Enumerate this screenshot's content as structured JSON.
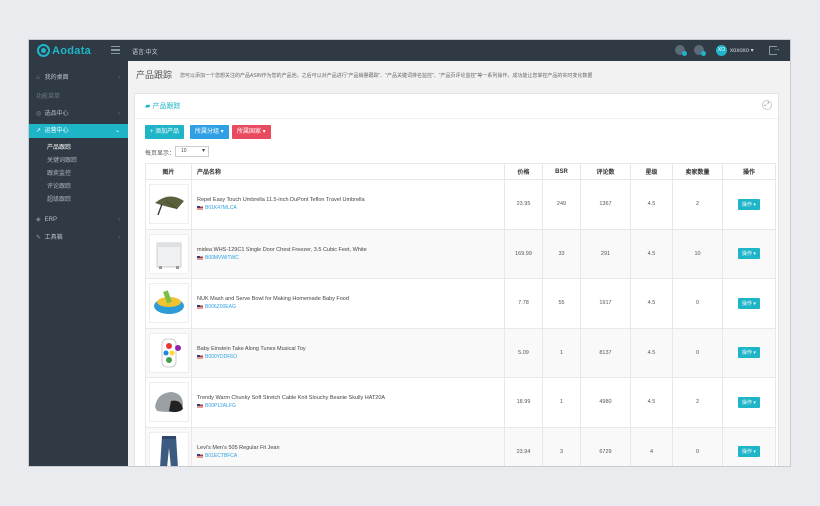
{
  "app": {
    "logo_text": "Aodata",
    "lang": "语言:中文",
    "user": "xoxoxo",
    "avatar": "XO"
  },
  "sidebar": {
    "items": [
      {
        "icon": "home-icon",
        "label": "我的桌面"
      },
      {
        "label": "功能菜单"
      },
      {
        "icon": "select-icon",
        "label": "选品中心"
      },
      {
        "icon": "chart-icon",
        "label": "运营中心"
      },
      {
        "icon": "erp-icon",
        "label": "ERP"
      },
      {
        "icon": "tools-icon",
        "label": "工具箱"
      }
    ],
    "sub_items": [
      "产品跟踪",
      "关键词跟踪",
      "跟卖监控",
      "评论跟踪",
      "超级跟踪"
    ]
  },
  "page": {
    "title": "产品跟踪",
    "desc": "您可以添加一个您想关注的产品ASIN作为您的产品池，之后可以对产品进行\"产品销量跟踪\"、\"产品关键词排名监控\"、\"产品页评论监控\"等一系列操作，成功能让您掌控产品的实时变化数据"
  },
  "panel": {
    "title": "产品跟踪",
    "btn_add": "+ 添加产品",
    "btn_group": "所属分组 ▾",
    "btn_country": "所属国家 ▾",
    "perpage_label": "每页显示：",
    "perpage_value": "10"
  },
  "table": {
    "headers": [
      "图片",
      "产品名称",
      "价格",
      "BSR",
      "评论数",
      "星级",
      "卖家数量",
      "操作"
    ],
    "rows": [
      {
        "img": "umbrella",
        "name": "Repel Easy Touch Umbrella 11.5-inch DuPont Teflon Travel Umbrella",
        "asin": "B01K47MLCA",
        "price": "23.95",
        "bsr": "249",
        "reviews": "1367",
        "stars": "4.5",
        "sellers": "2",
        "op": "操作 ▾"
      },
      {
        "img": "freezer",
        "name": "midea WHS-129C1 Single Door Chest Freezer, 3.5 Cubic Feet, White",
        "asin": "B00MVWITWC",
        "price": "169.99",
        "bsr": "33",
        "reviews": "291",
        "stars": "4.5",
        "sellers": "10",
        "op": "操作 ▾"
      },
      {
        "img": "bowl",
        "name": "NUK Mash and Serve Bowl for Making Homemade Baby Food",
        "asin": "B006Z00EAG",
        "price": "7.78",
        "bsr": "55",
        "reviews": "1917",
        "stars": "4.5",
        "sellers": "0",
        "op": "操作 ▾"
      },
      {
        "img": "toy",
        "name": "Baby Einstein Take Along Tunes Musical Toy",
        "asin": "B000YDDF6O",
        "price": "5.09",
        "bsr": "1",
        "reviews": "8137",
        "stars": "4.5",
        "sellers": "0",
        "op": "操作 ▾"
      },
      {
        "img": "beanie",
        "name": "Trendy Warm Chunky Soft Stretch Cable Knit Slouchy Beanie Skully HAT20A",
        "asin": "B00P12ALFG",
        "price": "18.99",
        "bsr": "1",
        "reviews": "4980",
        "stars": "4.5",
        "sellers": "2",
        "op": "操作 ▾"
      },
      {
        "img": "jeans",
        "name": "Levi's Men's 505 Regular Fit Jean",
        "asin": "B01ECTBFCA",
        "price": "23.94",
        "bsr": "3",
        "reviews": "6729",
        "stars": "4",
        "sellers": "0",
        "op": "操作 ▾"
      }
    ]
  },
  "colors": {
    "accent": "#1fb5c8",
    "sidebar": "#2f3a45",
    "blue": "#2fa0e4",
    "red": "#e84a5f"
  }
}
